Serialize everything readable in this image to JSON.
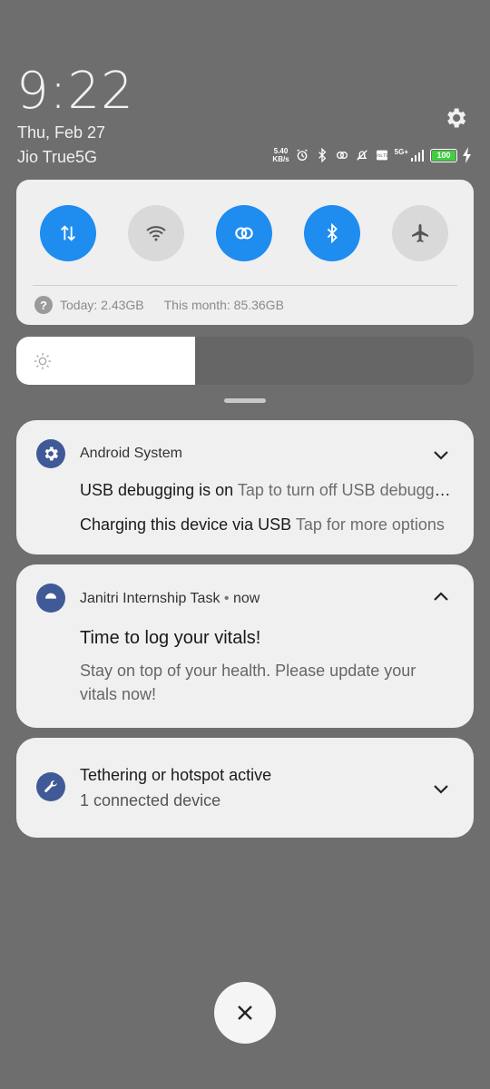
{
  "status": {
    "time": "9:22",
    "date": "Thu, Feb 27",
    "carrier": "Jio True5G",
    "net_speed_value": "5.40",
    "net_speed_unit": "KB/s",
    "battery_level": "100",
    "network_type": "5G+"
  },
  "quick_settings": {
    "tiles": [
      {
        "name": "mobile-data",
        "icon": "arrows-updown-icon",
        "active": true
      },
      {
        "name": "wifi",
        "icon": "wifi-icon",
        "active": false
      },
      {
        "name": "hotspot",
        "icon": "link-icon",
        "active": true
      },
      {
        "name": "bluetooth",
        "icon": "bluetooth-icon",
        "active": true
      },
      {
        "name": "airplane-mode",
        "icon": "airplane-icon",
        "active": false
      }
    ],
    "data_usage_today": "Today: 2.43GB",
    "data_usage_month": "This month: 85.36GB"
  },
  "brightness": {
    "level_fraction": 0.39
  },
  "notifications": {
    "android_system": {
      "app_name": "Android System",
      "rows": [
        {
          "title": "USB debugging is on",
          "text": "Tap to turn off USB debugging"
        },
        {
          "title": "Charging this device via USB",
          "text": "Tap for more options"
        }
      ]
    },
    "janitri": {
      "app_name": "Janitri Internship Task",
      "time": "now",
      "title": "Time to log your vitals!",
      "text": "Stay on top of your health. Please update your vitals now!"
    },
    "tethering": {
      "title": "Tethering or hotspot active",
      "text": "1 connected device"
    }
  },
  "colors": {
    "accent": "#1f8cf0",
    "background": "#6e6e6e",
    "card": "#f0f0f1",
    "app_icon": "#3f5a96"
  }
}
